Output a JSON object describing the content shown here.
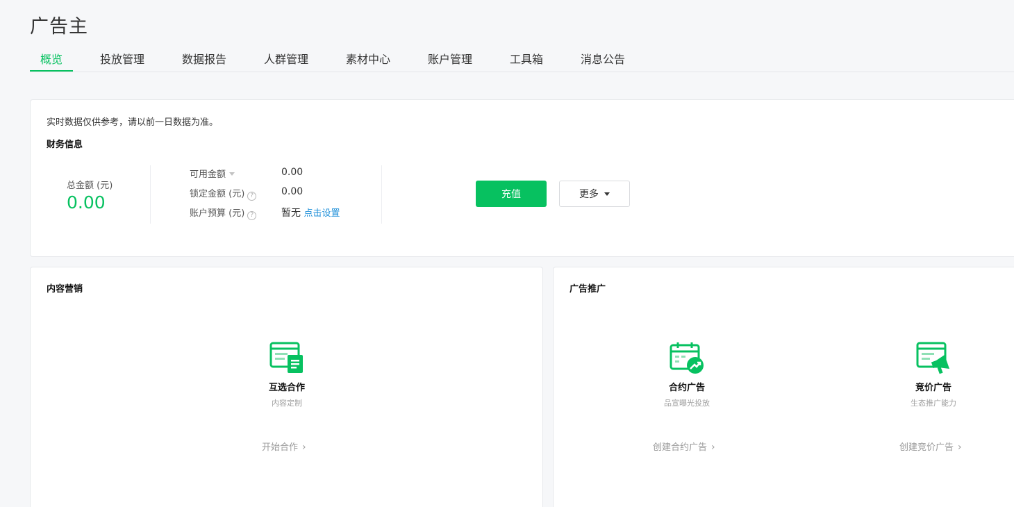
{
  "header": {
    "title": "广告主"
  },
  "tabs": [
    {
      "label": "概览",
      "active": true
    },
    {
      "label": "投放管理"
    },
    {
      "label": "数据报告"
    },
    {
      "label": "人群管理"
    },
    {
      "label": "素材中心"
    },
    {
      "label": "账户管理"
    },
    {
      "label": "工具箱"
    },
    {
      "label": "消息公告"
    }
  ],
  "finance": {
    "notice": "实时数据仅供参考，请以前一日数据为准。",
    "section_title": "财务信息",
    "total_label": "总金额 (元)",
    "total_value": "0.00",
    "available_label": "可用金额",
    "available_value": "0.00",
    "locked_label": "锁定金额 (元)",
    "locked_value": "0.00",
    "budget_label": "账户预算 (元)",
    "budget_value": "暂无",
    "budget_link": "点击设置",
    "recharge_button": "充值",
    "more_button": "更多"
  },
  "content_marketing": {
    "title": "内容营销",
    "item": {
      "icon": "content-customization-icon",
      "title": "互选合作",
      "subtitle": "内容定制",
      "link": "开始合作"
    }
  },
  "ad_promotion": {
    "title": "广告推广",
    "items": [
      {
        "icon": "calendar-trend-icon",
        "title": "合约广告",
        "subtitle": "品宣曝光投放",
        "link": "创建合约广告"
      },
      {
        "icon": "megaphone-icon",
        "title": "竞价广告",
        "subtitle": "生态推广能力",
        "link": "创建竞价广告"
      }
    ]
  },
  "colors": {
    "accent": "#07c160",
    "link": "#1e8fd9"
  }
}
